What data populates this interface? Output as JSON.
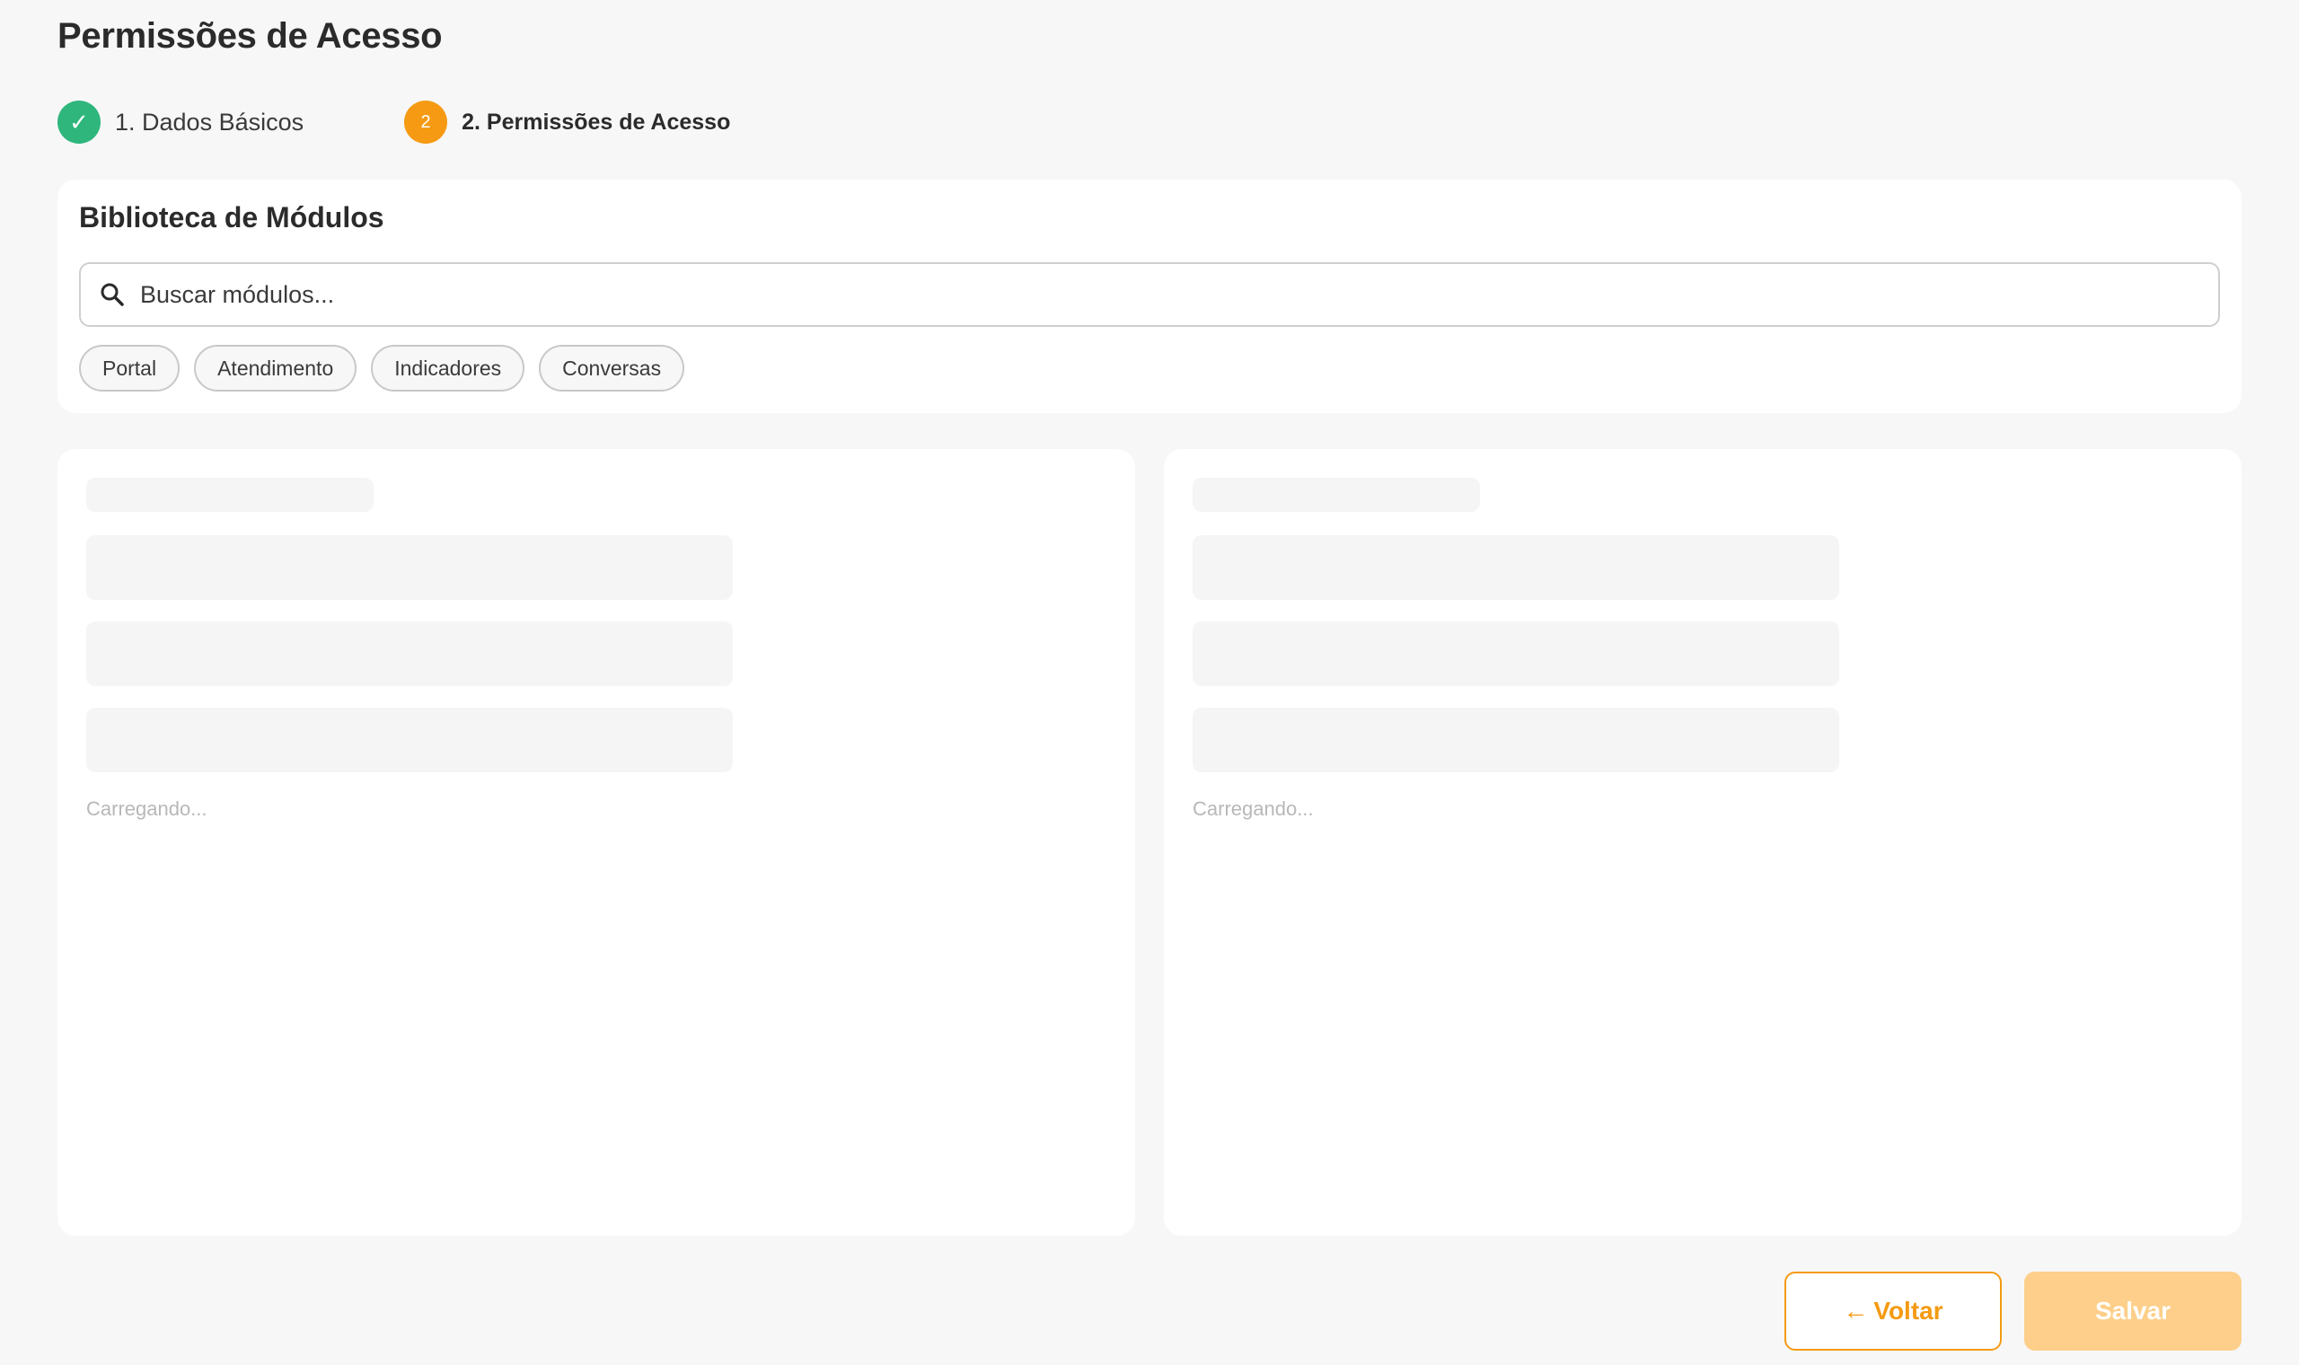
{
  "page": {
    "title": "Permissões de Acesso"
  },
  "stepper": {
    "steps": [
      {
        "label": "1. Dados Básicos",
        "indicator": "✓",
        "state": "done"
      },
      {
        "label": "2. Permissões de Acesso",
        "indicator": "2",
        "state": "active"
      }
    ]
  },
  "library": {
    "title": "Biblioteca de Módulos",
    "search_placeholder": "Buscar módulos...",
    "search_value": "",
    "search_icon": "search-icon",
    "filters": [
      "Portal",
      "Atendimento",
      "Indicadores",
      "Conversas"
    ]
  },
  "panels": {
    "left": {
      "loading_text": "Carregando..."
    },
    "right": {
      "loading_text": "Carregando..."
    }
  },
  "footer": {
    "back_arrow": "←",
    "back_label": "Voltar",
    "save_label": "Salvar"
  },
  "colors": {
    "accent": "#f59a12",
    "success": "#2fb67c",
    "save_disabled": "#fdcf8a",
    "background": "#f7f7f7"
  }
}
